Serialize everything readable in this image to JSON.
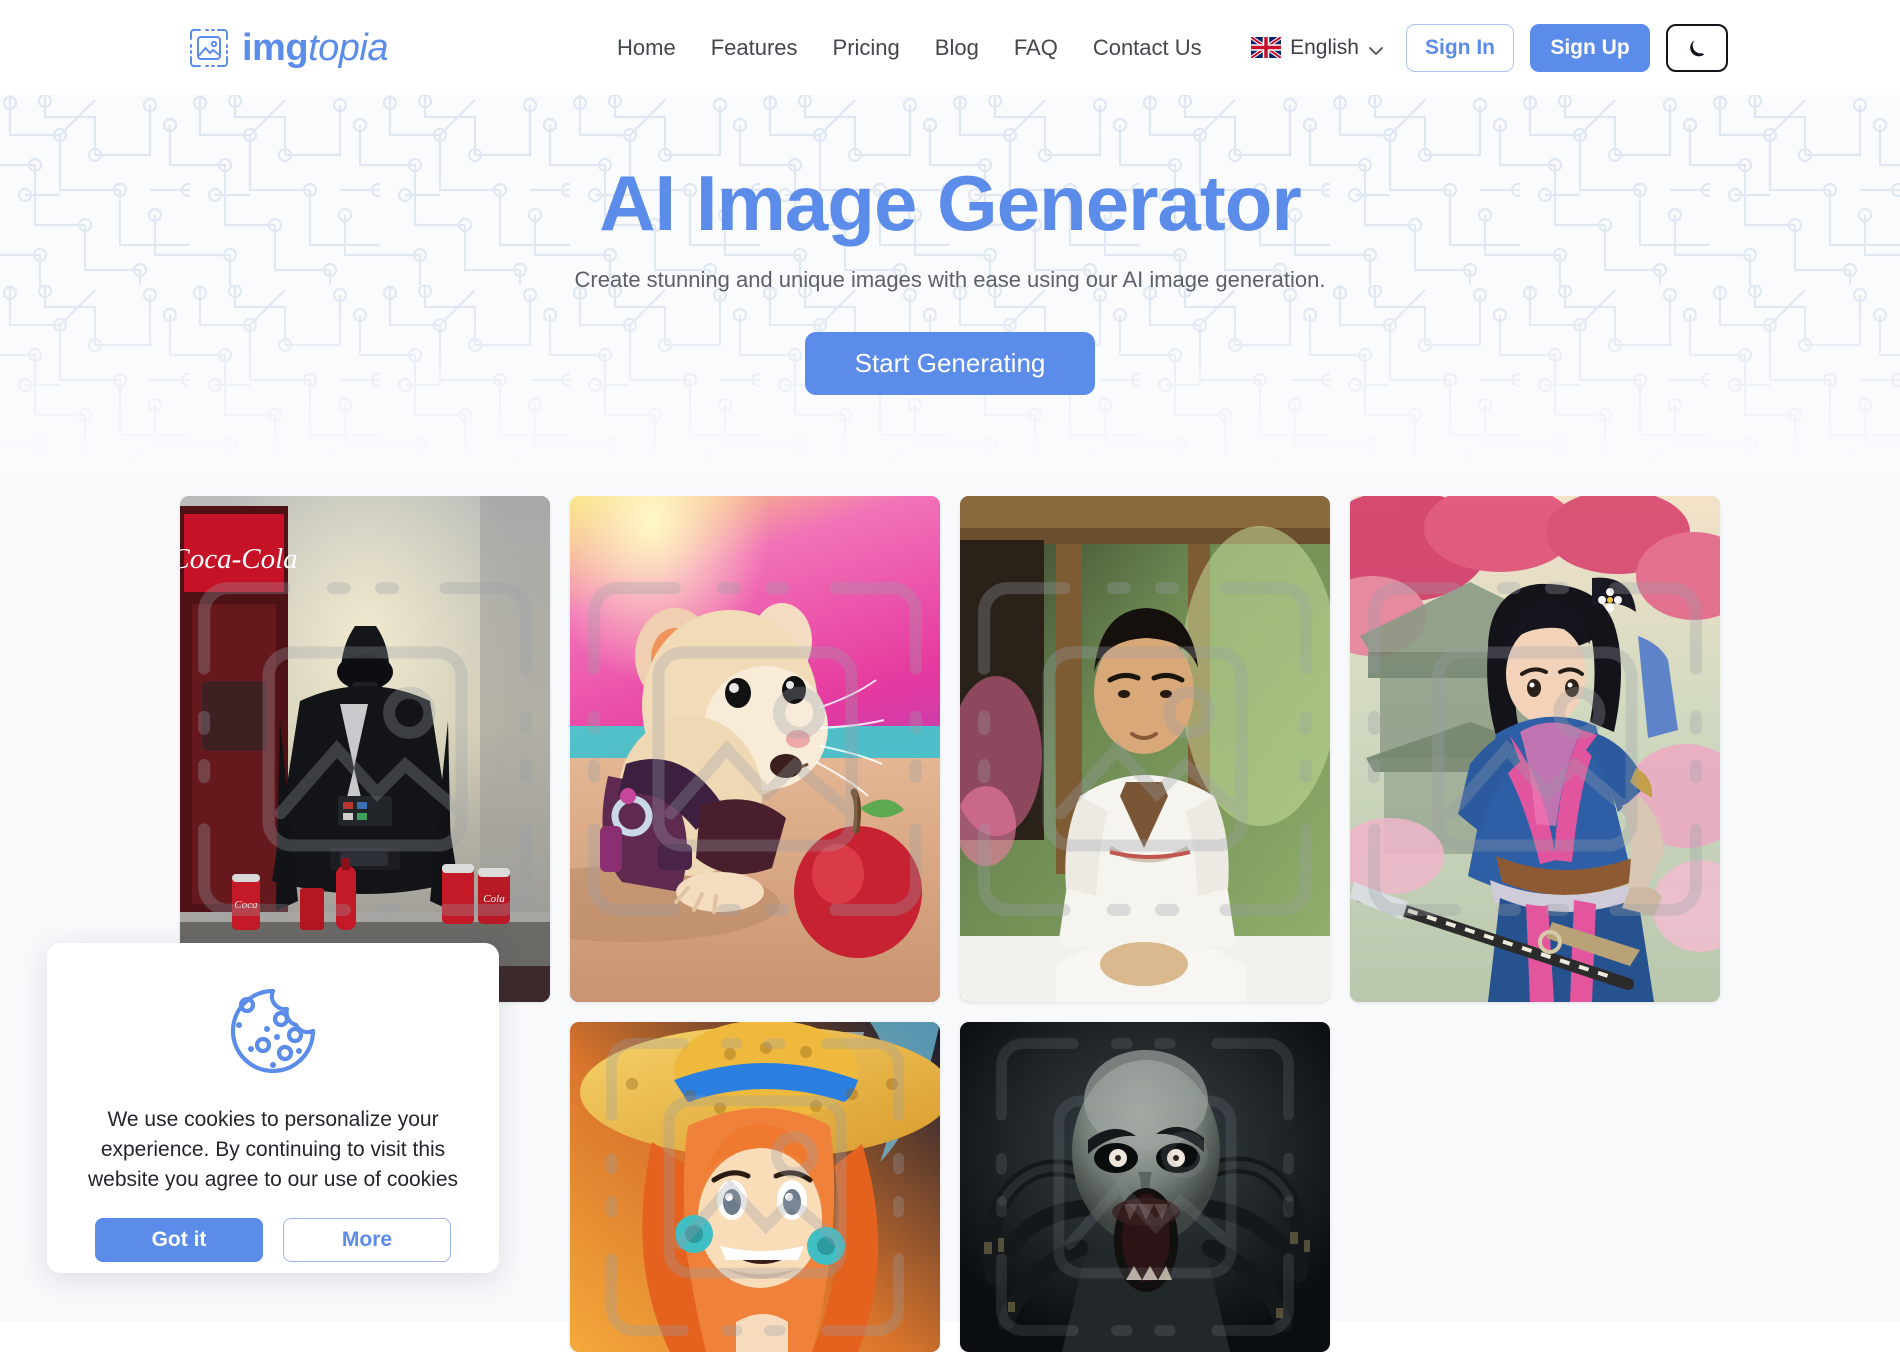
{
  "brand": {
    "name_bold": "img",
    "name_italic": "topia",
    "logo_icon": "image-frame-icon",
    "accent_color": "#5b8cea"
  },
  "header": {
    "nav": [
      {
        "label": "Home",
        "name": "nav-home"
      },
      {
        "label": "Features",
        "name": "nav-features"
      },
      {
        "label": "Pricing",
        "name": "nav-pricing"
      },
      {
        "label": "Blog",
        "name": "nav-blog"
      },
      {
        "label": "FAQ",
        "name": "nav-faq"
      },
      {
        "label": "Contact Us",
        "name": "nav-contact-us"
      }
    ],
    "language": {
      "label": "English",
      "flag": "uk-flag-icon",
      "chevron": "chevron-down-icon"
    },
    "sign_in": "Sign In",
    "sign_up": "Sign Up",
    "theme_toggle_icon": "moon-icon"
  },
  "hero": {
    "title": "AI Image Generator",
    "subtitle": "Create stunning and unique images with ease using our AI image generation.",
    "cta": "Start Generating",
    "background": "circuit-board-pattern",
    "title_color": "#5b8cea",
    "background_color": "#fafbfd"
  },
  "gallery": {
    "items": [
      {
        "name": "gallery-image-darth-vader-cocacola",
        "alt": "Darth Vader standing at a Coca-Cola bar with cans and bottles",
        "size": "tall"
      },
      {
        "name": "gallery-image-hamster-apple",
        "alt": "Cyberpunk hamster with backpack beside a red apple on a beach",
        "size": "tall"
      },
      {
        "name": "gallery-image-spa-therapist",
        "alt": "Man in white uniform seated in a spa interior",
        "size": "tall"
      },
      {
        "name": "gallery-image-anime-samurai",
        "alt": "Anime samurai woman in blue kimono with katana near cherry blossoms",
        "size": "tall"
      },
      {
        "name": "gallery-image-anime-straw-hat-girl",
        "alt": "Anime girl with orange hair and yellow straw hat",
        "size": "short"
      },
      {
        "name": "gallery-image-horror-creature",
        "alt": "Dark horror creature with pale eyes and spider limbs",
        "size": "short"
      }
    ],
    "background_color": "#f8f9fb"
  },
  "cookie_banner": {
    "icon": "cookie-icon",
    "message": "We use cookies to personalize your experience. By continuing to visit this website you agree to our use of cookies",
    "accept_label": "Got it",
    "more_label": "More"
  }
}
